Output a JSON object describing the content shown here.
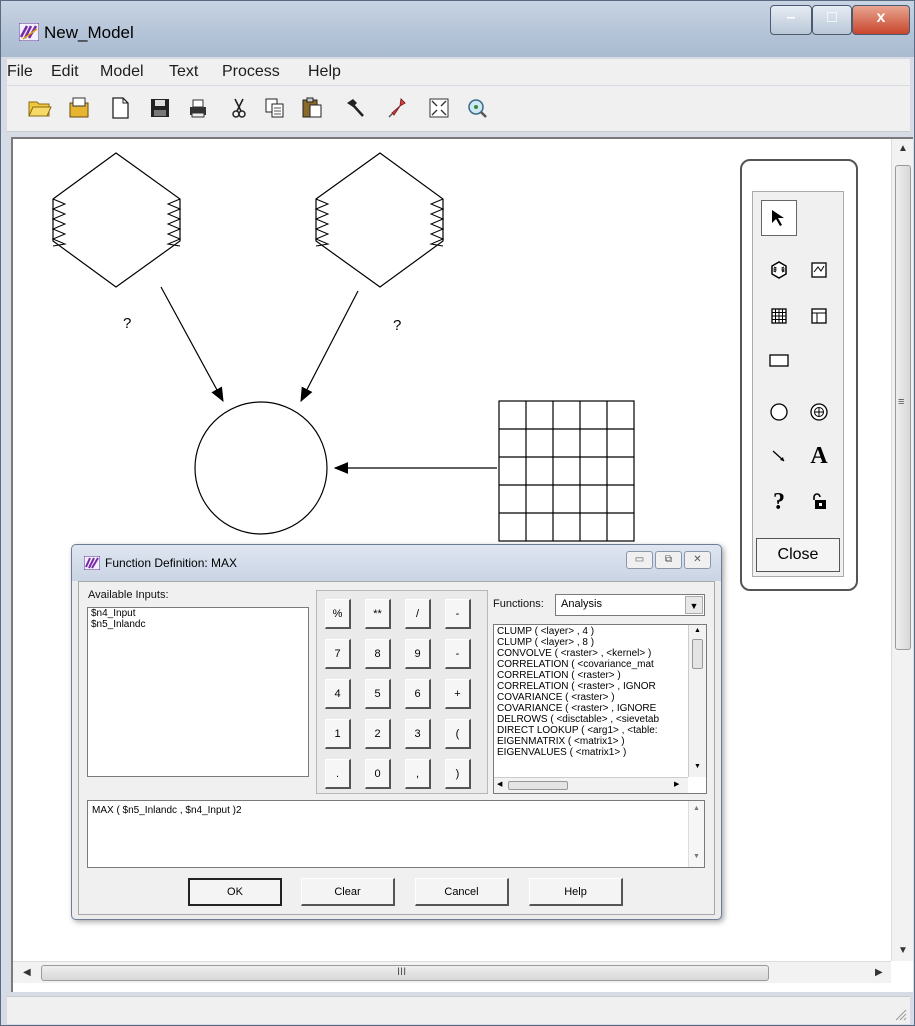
{
  "window": {
    "title": "New_Model",
    "controls": {
      "minimize": "–",
      "maximize": "□",
      "close": "x"
    }
  },
  "menu": [
    "File",
    "Edit",
    "Model",
    "Text",
    "Process",
    "Help"
  ],
  "toolbar_icons": [
    "open-folder-icon",
    "open-file-icon",
    "new-document-icon",
    "save-icon",
    "print-icon",
    "cut-icon",
    "copy-icon",
    "paste-icon",
    "hammer-icon",
    "pin-icon",
    "fit-window-icon",
    "zoom-icon"
  ],
  "model": {
    "raster1_label": "?",
    "raster2_label": "?"
  },
  "palette": {
    "tools": [
      "arrow-select-icon",
      "raster-icon",
      "vector-icon",
      "matrix-icon",
      "table-icon",
      "scalar-icon",
      "function-circle-icon",
      "criteria-icon",
      "connect-icon",
      "text-icon",
      "help-icon",
      "lock-icon"
    ],
    "text_tool": "A",
    "help_tool": "?",
    "close_label": "Close"
  },
  "dialog": {
    "title": "Function Definition:  MAX",
    "available_inputs_label": "Available Inputs:",
    "inputs": [
      "$n4_Input",
      "$n5_Inlandc"
    ],
    "keys": [
      "%",
      "**",
      "/",
      "-",
      "7",
      "8",
      "9",
      "-",
      "4",
      "5",
      "6",
      "+",
      "1",
      "2",
      "3",
      "(",
      ".",
      "0",
      ",",
      ")"
    ],
    "functions_label": "Functions:",
    "functions_category": "Analysis",
    "functions": [
      "CLUMP ( <layer> , 4 )",
      "CLUMP ( <layer> , 8 )",
      "CONVOLVE ( <raster> , <kernel> )",
      "CORRELATION ( <covariance_mat",
      "CORRELATION ( <raster> )",
      "CORRELATION ( <raster> , IGNOR",
      "COVARIANCE ( <raster> )",
      "COVARIANCE ( <raster> , IGNORE",
      "DELROWS ( <disctable> , <sievetab",
      "DIRECT LOOKUP ( <arg1> , <table:",
      "EIGENMATRIX ( <matrix1> )",
      "EIGENVALUES ( <matrix1> )"
    ],
    "expression": "MAX ( $n5_Inlandc , $n4_Input )2",
    "buttons": {
      "ok": "OK",
      "clear": "Clear",
      "cancel": "Cancel",
      "help": "Help"
    }
  },
  "scrollbar": {
    "h_grip": "III",
    "v_grip": "≡"
  }
}
